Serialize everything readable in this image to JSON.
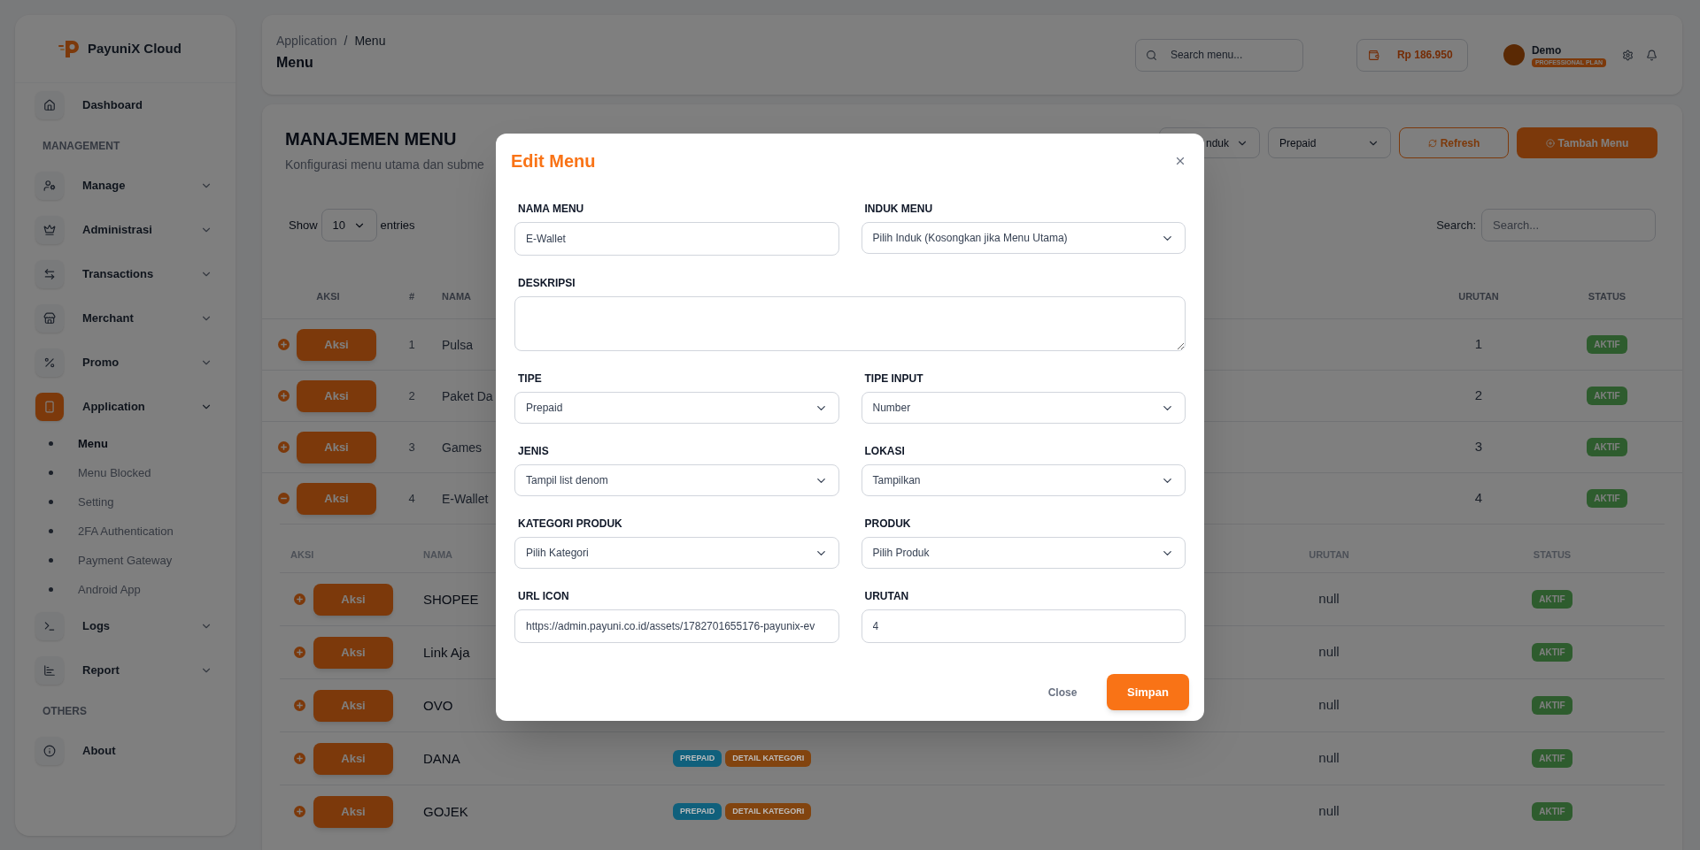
{
  "sidebar": {
    "brand": "PayuniX Cloud",
    "sections": [
      {
        "items": [
          {
            "label": "Dashboard",
            "kind": "link",
            "selected": false
          }
        ]
      },
      {
        "title": "MANAGEMENT",
        "items": [
          {
            "label": "Manage",
            "kind": "dropdown",
            "selected": false
          },
          {
            "label": "Administrasi",
            "kind": "dropdown",
            "selected": false
          },
          {
            "label": "Transactions",
            "kind": "dropdown",
            "selected": false
          },
          {
            "label": "Merchant",
            "kind": "dropdown",
            "selected": false
          },
          {
            "label": "Promo",
            "kind": "dropdown",
            "selected": false
          },
          {
            "label": "Application",
            "kind": "dropdown",
            "selected": true,
            "expanded": true,
            "children": [
              {
                "label": "Menu",
                "selected": true
              },
              {
                "label": "Menu Blocked",
                "selected": false
              },
              {
                "label": "Setting",
                "selected": false
              },
              {
                "label": "2FA Authentication",
                "selected": false
              },
              {
                "label": "Payment Gateway",
                "selected": false
              },
              {
                "label": "Android App",
                "selected": false
              }
            ]
          },
          {
            "label": "Logs",
            "kind": "dropdown",
            "selected": false
          },
          {
            "label": "Report",
            "kind": "dropdown",
            "selected": false
          }
        ]
      },
      {
        "title": "OTHERS",
        "items": [
          {
            "label": "About",
            "kind": "link",
            "selected": false
          }
        ]
      }
    ]
  },
  "header": {
    "breadcrumb": {
      "items": [
        "Application",
        "Menu"
      ],
      "separator": "/"
    },
    "title": "Menu",
    "search": {
      "placeholder": "Search menu..."
    },
    "balance": "Rp 186.950",
    "user": {
      "name": "Demo",
      "plan": "PROFESSIONAL PLAN"
    }
  },
  "content": {
    "title": "MANAJEMEN MENU",
    "subtitle": "Konfigurasi menu utama dan subme",
    "filters": [
      {
        "value": "nduk"
      },
      {
        "value": "Prepaid"
      }
    ],
    "buttons": [
      {
        "label": "Refresh",
        "kind": "outline"
      },
      {
        "label": "Tambah Menu",
        "kind": "primary"
      }
    ],
    "length": {
      "before": "Show",
      "value": "10",
      "after": "entries"
    },
    "search": {
      "label": "Search:",
      "placeholder": "Search..."
    },
    "table": {
      "columns": [
        "AKSI",
        "#",
        "NAMA",
        "URUTAN",
        "STATUS"
      ],
      "rows": [
        {
          "action": "Aksi",
          "number": "1",
          "name": "Pulsa",
          "order": "1",
          "status": "AKTIF",
          "expanded": false
        },
        {
          "action": "Aksi",
          "number": "2",
          "name": "Paket Da",
          "order": "2",
          "status": "AKTIF",
          "expanded": false
        },
        {
          "action": "Aksi",
          "number": "3",
          "name": "Games",
          "order": "3",
          "status": "AKTIF",
          "expanded": false
        },
        {
          "action": "Aksi",
          "number": "4",
          "name": "E-Wallet",
          "order": "4",
          "status": "AKTIF",
          "expanded": true
        }
      ]
    },
    "subtable": {
      "columns": [
        "AKSI",
        "NAMA",
        "URUTAN",
        "STATUS"
      ],
      "rows": [
        {
          "action": "Aksi",
          "name": "SHOPEE",
          "order": "null",
          "status": "AKTIF",
          "expanded": false
        },
        {
          "action": "Aksi",
          "name": "Link Aja",
          "order": "null",
          "status": "AKTIF",
          "expanded": false
        },
        {
          "action": "Aksi",
          "name": "OVO",
          "order": "null",
          "status": "AKTIF",
          "expanded": false
        },
        {
          "action": "Aksi",
          "name": "DANA",
          "badges": [
            {
              "label": "PREPAID",
              "color": "#10607c"
            },
            {
              "label": "DETAIL KATEGORI",
              "color": "#82440f"
            }
          ],
          "order": "null",
          "status": "AKTIF",
          "expanded": false
        },
        {
          "action": "Aksi",
          "name": "GOJEK",
          "badges": [
            {
              "label": "PREPAID",
              "color": "#10607c"
            },
            {
              "label": "DETAIL KATEGORI",
              "color": "#82440f"
            }
          ],
          "order": "null",
          "status": "AKTIF",
          "expanded": false
        }
      ]
    }
  },
  "modal": {
    "title": "Edit Menu",
    "fields": [
      {
        "label": "NAMA MENU",
        "kind": "text",
        "value": "E-Wallet"
      },
      {
        "label": "INDUK MENU",
        "kind": "select",
        "value": "Pilih Induk (Kosongkan jika Menu Utama)"
      },
      {
        "label": "DESKRIPSI",
        "kind": "textarea"
      },
      {
        "label": "TIPE",
        "kind": "select",
        "value": "Prepaid"
      },
      {
        "label": "TIPE INPUT",
        "kind": "select",
        "value": "Number"
      },
      {
        "label": "JENIS",
        "kind": "select",
        "value": "Tampil list denom"
      },
      {
        "label": "LOKASI",
        "kind": "select",
        "value": "Tampilkan"
      },
      {
        "label": "KATEGORI PRODUK",
        "kind": "select",
        "value": "Pilih Kategori"
      },
      {
        "label": "PRODUK",
        "kind": "select",
        "value": "Pilih Produk"
      },
      {
        "label": "URL ICON",
        "kind": "text",
        "value": "https://admin.payuni.co.id/assets/1782701655176-payunix-ev"
      },
      {
        "label": "URUTAN",
        "kind": "text",
        "value": "4"
      }
    ],
    "buttons": [
      {
        "label": "Close",
        "kind": "text"
      },
      {
        "label": "Simpan",
        "kind": "primary"
      }
    ]
  }
}
